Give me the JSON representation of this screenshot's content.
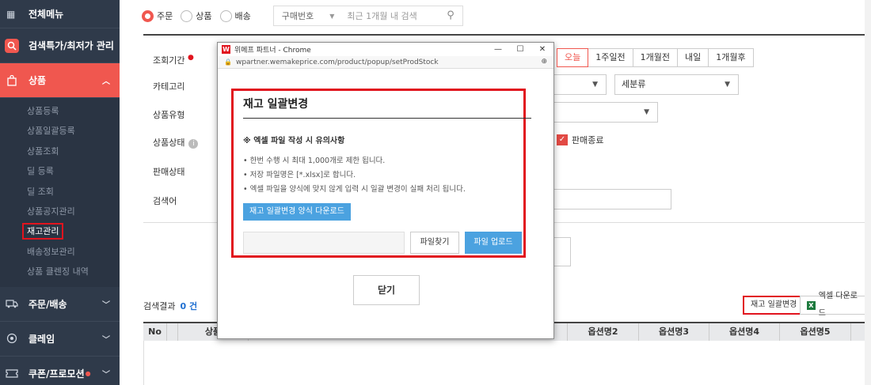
{
  "sidebar": {
    "all_menu": "전체메뉴",
    "search_price": "검색특가/최저가 관리",
    "product": "상품",
    "product_sub": [
      "상품등록",
      "상품일괄등록",
      "상품조회",
      "딜 등록",
      "딜 조회",
      "상품공지관리",
      "재고관리",
      "배송정보관리",
      "상품 클렌징 내역"
    ],
    "order": "주문/배송",
    "claim": "클레임",
    "coupon": "쿠폰/프로모션"
  },
  "search": {
    "radios": [
      "주문",
      "상품",
      "배송"
    ],
    "dropdown": "구매번호",
    "placeholder": "최근 1개월 내 검색"
  },
  "filters": {
    "period_label": "조회기간",
    "category_label": "카테고리",
    "type_label": "상품유형",
    "status_label": "상품상태",
    "sale_label": "판매상태",
    "keyword_label": "검색어",
    "period_buttons": [
      "오늘",
      "1주일전",
      "1개월전",
      "내일",
      "1개월후"
    ],
    "subcategory": "세분류",
    "checkbox_label": "판매종료"
  },
  "results": {
    "label": "검색결과",
    "count": "0 건",
    "bulk_button": "재고 일괄변경",
    "excel_button": "엑셀 다운로드",
    "columns": [
      "No",
      "상품",
      "옵션명2",
      "옵션명3",
      "옵션명4",
      "옵션명5"
    ]
  },
  "popup": {
    "window_title": "위메프 파트너 - Chrome",
    "url": "wpartner.wemakeprice.com/product/popup/setProdStock",
    "heading": "재고 일괄변경",
    "note_title": "※ 엑셀 파일 작성 시 유의사항",
    "notes": [
      "• 한번 수행 시 최대 1,000개로 제한 됩니다.",
      "• 저장 파일명은 [*.xlsx]로 합니다.",
      "• 엑셀 파일을 양식에 맞지 않게 입력 시 일괄 변경이 실패 처리 됩니다."
    ],
    "download_template": "재고 일괄변경 양식 다운로드",
    "find_file": "파일찾기",
    "upload": "파일 업로드",
    "close": "닫기"
  },
  "colors": {
    "accent": "#f0574f",
    "highlight": "#e1141e",
    "blue": "#4ba2e0",
    "sidebar": "#2f3a4a"
  }
}
